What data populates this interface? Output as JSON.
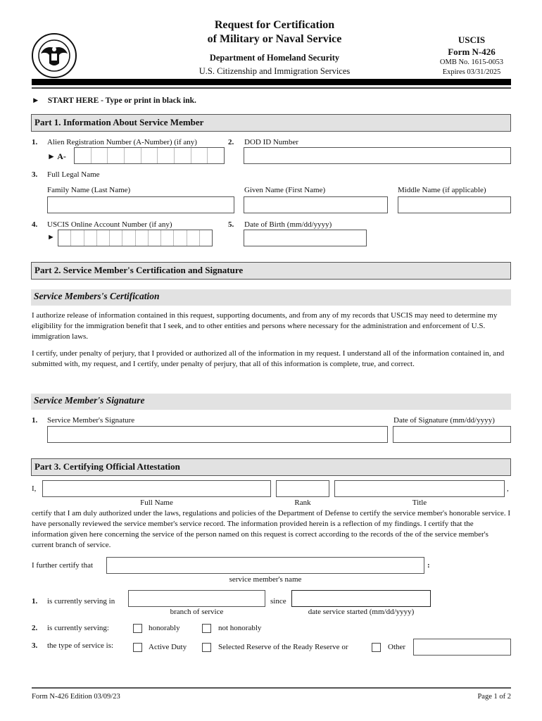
{
  "header": {
    "seal_icon": "dhs-seal-icon",
    "title_line1": "Request for Certification",
    "title_line2": "of Military or Naval Service",
    "department": "Department of Homeland Security",
    "agency": "U.S. Citizenship and Immigration Services",
    "uscis": "USCIS",
    "form_number": "Form N-426",
    "omb": "OMB No. 1615-0053",
    "expires": "Expires 03/31/2025"
  },
  "start_here": {
    "arrow_icon": "right-triangle-icon",
    "text": "START HERE - Type or print in black ink."
  },
  "part1": {
    "title": "Part 1.  Information About Service Member",
    "item1": {
      "num": "1.",
      "label": "Alien Registration Number (A-Number) (if any)",
      "prefix": "► A-",
      "cells": 9,
      "value": ""
    },
    "item2": {
      "num": "2.",
      "label": "DOD ID Number",
      "value": ""
    },
    "item3": {
      "num": "3.",
      "label": "Full Legal Name",
      "family_label": "Family Name (Last Name)",
      "family_value": "",
      "given_label": "Given Name (First Name)",
      "given_value": "",
      "middle_label": "Middle Name (if applicable)",
      "middle_value": ""
    },
    "item4": {
      "num": "4.",
      "label": "USCIS Online Account Number (if any)",
      "prefix": "►",
      "cells": 12,
      "value": ""
    },
    "item5": {
      "num": "5.",
      "label": "Date of Birth (mm/dd/yyyy)",
      "value": ""
    }
  },
  "part2": {
    "title": "Part 2.  Service Member's Certification and Signature",
    "certification_title": "Service Members's Certification",
    "para1": "I authorize release of information contained in this request, supporting documents, and from any of my records that USCIS may need to determine my eligibility for the immigration benefit that I seek, and to other entities and persons where necessary for the administration and enforcement of U.S. immigration laws.",
    "para2": "I certify, under penalty of perjury, that I provided or authorized all of the information in my request.  I understand all of the information contained in, and submitted with, my request, and I certify, under penalty of perjury, that all of this information is complete, true, and correct.",
    "signature_title": "Service Member's Signature",
    "sig_num": "1.",
    "sig_label": "Service Member's Signature",
    "sig_value": "",
    "date_label": "Date of Signature (mm/dd/yyyy)",
    "date_value": ""
  },
  "part3": {
    "title": "Part 3.  Certifying Official Attestation",
    "i_label": "I,",
    "comma": ",",
    "full_name_caption": "Full Name",
    "full_name_value": "",
    "rank_caption": "Rank",
    "rank_value": "",
    "title_caption": "Title",
    "title_value": "",
    "para": "certify that I am duly authorized under the laws, regulations and policies of the Department of Defense to certify the service member's honorable service.  I have personally reviewed the service member's service record.  The information provided herein is a reflection of my findings.  I certify that the information given here concerning the service of the person named on this request is correct according to the records of the of the service member's current branch of service.",
    "further_label": "I further certify that",
    "colon": ":",
    "member_name_caption": "service member's name",
    "member_name_value": "",
    "item1": {
      "num": "1.",
      "label": "is currently serving in",
      "branch_caption": "branch of service",
      "branch_value": "",
      "since": "since",
      "date_caption": "date service started (mm/dd/yyyy)",
      "date_value": ""
    },
    "item2": {
      "num": "2.",
      "label": "is currently serving:",
      "opt1": "honorably",
      "opt2": "not honorably",
      "opt1_checked": false,
      "opt2_checked": false
    },
    "item3": {
      "num": "3.",
      "label": "the type of service is:",
      "opt1": "Active Duty",
      "opt2": "Selected Reserve of the Ready Reserve or",
      "opt3": "Other",
      "other_value": ""
    }
  },
  "footer": {
    "left": "Form N-426   Edition   03/09/23",
    "right": "Page 1 of 2"
  }
}
